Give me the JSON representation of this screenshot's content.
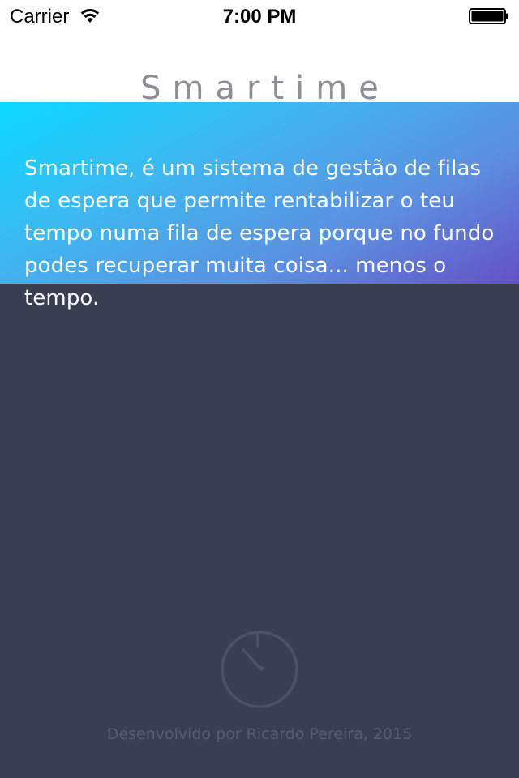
{
  "status_bar": {
    "carrier": "Carrier",
    "time": "7:00 PM",
    "wifi_icon": "wifi-icon",
    "battery_icon": "battery-full-icon"
  },
  "nav": {
    "title": "Smartime"
  },
  "intro": {
    "text": "Smartime, é um sistema de gestão de filas de espera que permite rentabilizar o teu tempo numa fila de espera porque no fundo podes recuperar muita coisa... menos o tempo."
  },
  "footer": {
    "logo_icon": "stopwatch-icon",
    "credit": "Desenvolvido por Ricardo Pereira, 2015"
  },
  "colors": {
    "background": "#393e50",
    "gradient_start": "#0bd9ff",
    "gradient_end": "#6450c4",
    "title": "#8e8e93",
    "footer_text": "#565c74"
  }
}
